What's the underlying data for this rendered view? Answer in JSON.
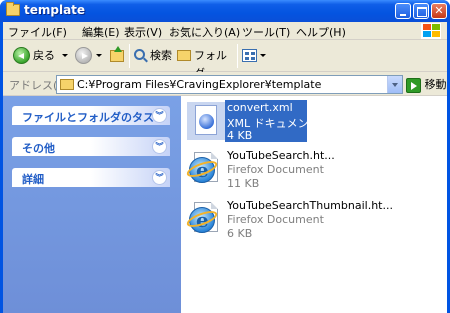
{
  "window": {
    "title": "template"
  },
  "menu": {
    "items": [
      "ファイル(F)",
      "編集(E)",
      "表示(V)",
      "お気に入り(A)",
      "ツール(T)",
      "ヘルプ(H)"
    ]
  },
  "toolbar": {
    "back_label": "戻る",
    "search_label": "検索",
    "folders_label": "フォルダ"
  },
  "address": {
    "label": "アドレス(D)",
    "path": "C:¥Program Files¥CravingExplorer¥template",
    "go_label": "移動"
  },
  "sidebar": {
    "panels": [
      {
        "label": "ファイルとフォルダのタスク",
        "icon": "chevron-double-down-icon"
      },
      {
        "label": "その他",
        "icon": "chevron-double-down-icon"
      },
      {
        "label": "詳細",
        "icon": "chevron-double-down-icon"
      }
    ]
  },
  "files": [
    {
      "name": "convert.xml",
      "type": "XML ドキュメント",
      "size": "4 KB",
      "icon": "xml-document-icon",
      "selected": true
    },
    {
      "name": "YouTubeSearch.ht...",
      "type": "Firefox Document",
      "size": "11 KB",
      "icon": "firefox-document-icon",
      "selected": false
    },
    {
      "name": "YouTubeSearchThumbnail.ht...",
      "type": "Firefox Document",
      "size": "6 KB",
      "icon": "firefox-document-icon",
      "selected": false
    }
  ],
  "colors": {
    "titlebar": "#0454e0",
    "sidebar": "#7aa1e6",
    "selection": "#316ac5",
    "chrome": "#ece9d8"
  }
}
